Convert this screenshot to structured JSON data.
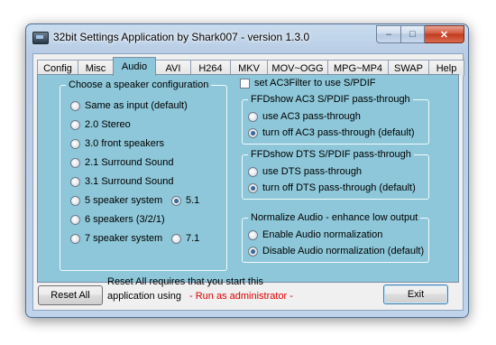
{
  "window": {
    "title": "32bit Settings Application by Shark007 - version 1.3.0",
    "minimize_label": "–",
    "maximize_label": "□",
    "close_label": "✕"
  },
  "tabs": [
    {
      "label": "Config",
      "active": false
    },
    {
      "label": "Misc",
      "active": false
    },
    {
      "label": "Audio",
      "active": true
    },
    {
      "label": "AVI",
      "active": false
    },
    {
      "label": "H264",
      "active": false
    },
    {
      "label": "MKV",
      "active": false
    },
    {
      "label": "MOV~OGG",
      "active": false
    },
    {
      "label": "MPG~MP4",
      "active": false
    },
    {
      "label": "SWAP",
      "active": false
    },
    {
      "label": "Help",
      "active": false
    }
  ],
  "speaker": {
    "legend": "Choose a speaker configuration",
    "options": [
      {
        "label": "Same as input (default)",
        "selected": false
      },
      {
        "label": "2.0 Stereo",
        "selected": false
      },
      {
        "label": "3.0 front speakers",
        "selected": false
      },
      {
        "label": "2.1 Surround Sound",
        "selected": false
      },
      {
        "label": "3.1 Surround Sound",
        "selected": false
      },
      {
        "label": "5 speaker system",
        "selected": false
      },
      {
        "label": "6 speakers (3/2/1)",
        "selected": false
      },
      {
        "label": "7 speaker system",
        "selected": false
      }
    ],
    "sub_51": {
      "label": "5.1",
      "selected": true
    },
    "sub_71": {
      "label": "7.1",
      "selected": false
    }
  },
  "ac3filter": {
    "label": "set AC3Filter to use S/PDIF",
    "checked": false
  },
  "ac3_spdif": {
    "legend": "FFDshow AC3 S/PDIF pass-through",
    "options": [
      {
        "label": "use AC3 pass-through",
        "selected": false
      },
      {
        "label": "turn off AC3 pass-through (default)",
        "selected": true
      }
    ]
  },
  "dts_spdif": {
    "legend": "FFDshow DTS S/PDIF pass-through",
    "options": [
      {
        "label": "use DTS pass-through",
        "selected": false
      },
      {
        "label": "turn off DTS pass-through (default)",
        "selected": true
      }
    ]
  },
  "normalize": {
    "legend": "Normalize Audio - enhance low output",
    "options": [
      {
        "label": "Enable Audio normalization",
        "selected": false
      },
      {
        "label": "Disable Audio normalization (default)",
        "selected": true
      }
    ]
  },
  "footer": {
    "reset_label": "Reset All",
    "note_line1": "Reset All requires that you start this",
    "note_line2": "application using",
    "note_admin": "- Run as administrator -",
    "exit_label": "Exit"
  }
}
